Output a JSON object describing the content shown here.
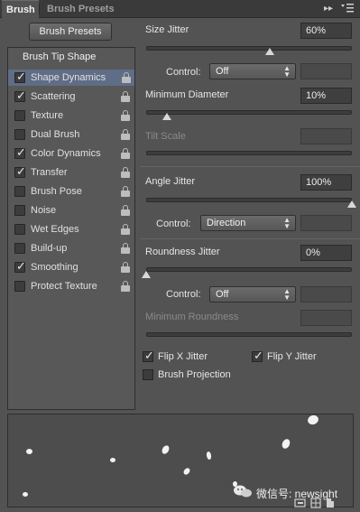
{
  "tabs": [
    {
      "label": "Brush",
      "active": true
    },
    {
      "label": "Brush Presets",
      "active": false
    }
  ],
  "toolbar_icons": [
    "double-chevron-right-icon",
    "panel-menu-icon"
  ],
  "brush_presets_button": "Brush Presets",
  "brush_tip_shape": "Brush Tip Shape",
  "options": [
    {
      "label": "Shape Dynamics",
      "checked": true,
      "selected": true
    },
    {
      "label": "Scattering",
      "checked": true
    },
    {
      "label": "Texture",
      "checked": false
    },
    {
      "label": "Dual Brush",
      "checked": false
    },
    {
      "label": "Color Dynamics",
      "checked": true
    },
    {
      "label": "Transfer",
      "checked": true
    },
    {
      "label": "Brush Pose",
      "checked": false
    },
    {
      "label": "Noise",
      "checked": false
    },
    {
      "label": "Wet Edges",
      "checked": false
    },
    {
      "label": "Build-up",
      "checked": false
    },
    {
      "label": "Smoothing",
      "checked": true
    },
    {
      "label": "Protect Texture",
      "checked": false
    }
  ],
  "size_jitter": {
    "label": "Size Jitter",
    "value": "60%",
    "slider": 0.6
  },
  "control1": {
    "label": "Control:",
    "value": "Off"
  },
  "min_diameter": {
    "label": "Minimum Diameter",
    "value": "10%",
    "slider": 0.1
  },
  "tilt_scale": {
    "label": "Tilt Scale"
  },
  "angle_jitter": {
    "label": "Angle Jitter",
    "value": "100%",
    "slider": 1.0
  },
  "control2": {
    "label": "Control:",
    "value": "Direction"
  },
  "roundness_jitter": {
    "label": "Roundness Jitter",
    "value": "0%",
    "slider": 0.0
  },
  "control3": {
    "label": "Control:",
    "value": "Off"
  },
  "min_roundness": {
    "label": "Minimum Roundness"
  },
  "flip_x": {
    "label": "Flip X Jitter",
    "checked": true
  },
  "flip_y": {
    "label": "Flip Y Jitter",
    "checked": true
  },
  "brush_projection": {
    "label": "Brush Projection",
    "checked": false
  },
  "watermark": "微信号: newsight",
  "bottom_icons": [
    "brush-preview-icon",
    "grid-icon",
    "new-preset-icon"
  ]
}
